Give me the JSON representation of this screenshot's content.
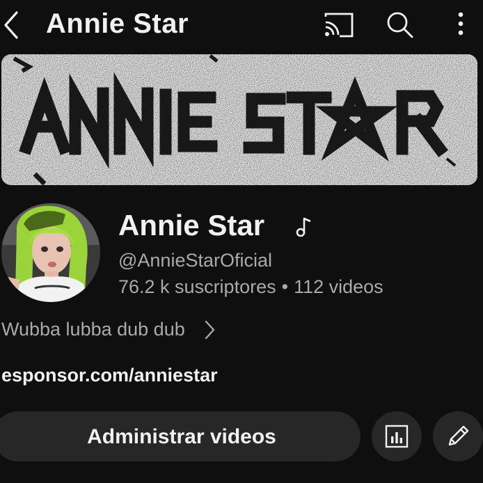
{
  "header": {
    "title": "Annie Star",
    "icons": [
      "back-arrow-icon",
      "cast-icon",
      "search-icon",
      "more-vertical-icon"
    ]
  },
  "banner": {
    "text": "ANNIE STAR",
    "background": "#e2e2e2",
    "ink": "#1a1a1a"
  },
  "channel": {
    "name": "Annie Star",
    "badge_icon": "music-note-icon",
    "handle": "@AnnieStarOficial",
    "subscribers": "76.2 k suscriptores",
    "separator": "•",
    "videos": "112 videos",
    "description": "Wubba lubba dub dub",
    "link": "esponsor.com/anniestar"
  },
  "actions": {
    "manage_label": "Administrar videos",
    "analytics_icon": "analytics-icon",
    "edit_icon": "pencil-icon"
  },
  "colors": {
    "background": "#0f0f0f",
    "button": "#272727",
    "primary_text": "#f1f1f1",
    "secondary_text": "#aaaaaa",
    "avatar_hair": "#9bd43a"
  }
}
